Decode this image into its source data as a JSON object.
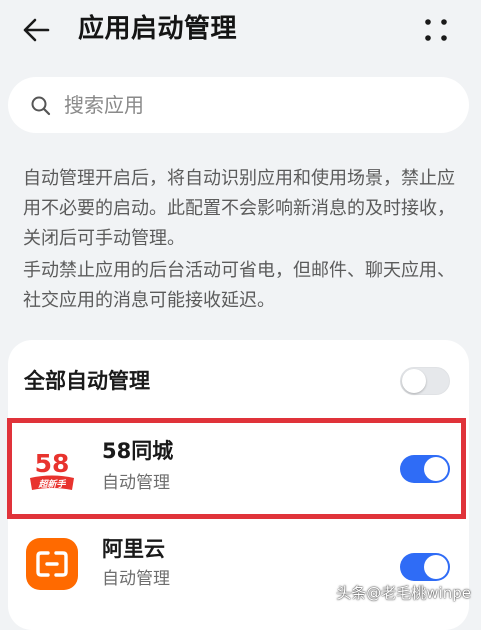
{
  "header": {
    "title": "应用启动管理",
    "back_icon": "arrow-left-icon",
    "more_icon": "more-grid-icon"
  },
  "search": {
    "placeholder": "搜索应用",
    "value": "",
    "icon": "search-icon"
  },
  "description": {
    "paragraph_1": "自动管理开启后，将自动识别应用和使用场景，禁止应用不必要的启动。此配置不会影响新消息的及时接收，关闭后可手动管理。",
    "paragraph_2": "手动禁止应用的后台活动可省电，但邮件、聊天应用、社交应用的消息可能接收延迟。"
  },
  "master": {
    "label": "全部自动管理",
    "on": false
  },
  "apps": [
    {
      "name": "58同城",
      "status": "自动管理",
      "on": true,
      "icon": "58-logo-icon",
      "icon_badge": "58",
      "icon_caption": "超新手"
    },
    {
      "name": "阿里云",
      "status": "自动管理",
      "on": true,
      "icon": "aliyun-logo-icon"
    }
  ],
  "colors": {
    "accent": "#2f6cf6",
    "background": "#f1f3f5",
    "card": "#ffffff",
    "highlight_border": "#e0333a",
    "aliyun_orange": "#ff6a00",
    "logo_red": "#e8332e"
  },
  "watermark": {
    "text": "头条@老毛桃winpe"
  }
}
